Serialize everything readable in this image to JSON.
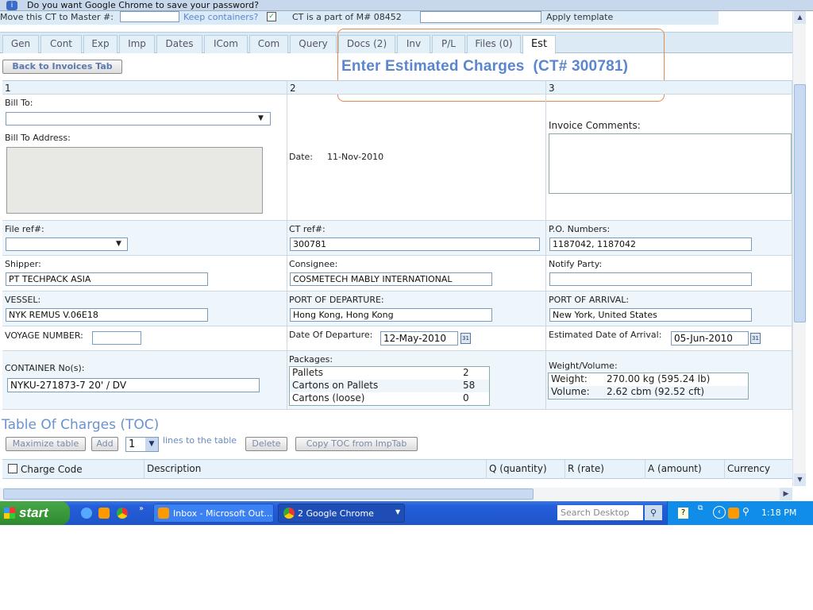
{
  "infobar": {
    "text": "Do you want Google Chrome to save your password?"
  },
  "toolbar": {
    "move_label": "Move this CT to Master #:",
    "keep_containers": "Keep containers?",
    "part_of": "CT is a part of M# 08452",
    "apply_template": "Apply template"
  },
  "tabs": [
    {
      "label": "Gen"
    },
    {
      "label": "Cont"
    },
    {
      "label": "Exp"
    },
    {
      "label": "Imp"
    },
    {
      "label": "Dates"
    },
    {
      "label": "ICom"
    },
    {
      "label": "Com"
    },
    {
      "label": "Query"
    },
    {
      "label": "Docs (2)"
    },
    {
      "label": "Inv"
    },
    {
      "label": "P/L"
    },
    {
      "label": "Files (0)"
    },
    {
      "label": "Est"
    }
  ],
  "active_tab": "Est",
  "back_button": "Back to Invoices Tab",
  "page_title": "Enter Estimated Charges  (CT# 300781)",
  "columns": [
    "1",
    "2",
    "3"
  ],
  "form": {
    "bill_to_label": "Bill To:",
    "bill_to_value": "",
    "bill_to_address_label": "Bill To Address:",
    "date_label": "Date:",
    "date_value": "11-Nov-2010",
    "invoice_comments_label": "Invoice Comments:",
    "file_ref_label": "File ref#:",
    "file_ref_value": "",
    "ct_ref_label": "CT ref#:",
    "ct_ref_value": "300781",
    "po_label": "P.O. Numbers:",
    "po_value": "1187042, 1187042",
    "shipper_label": "Shipper:",
    "shipper_value": "PT TECHPACK ASIA",
    "consignee_label": "Consignee:",
    "consignee_value": "COSMETECH MABLY INTERNATIONAL",
    "notify_label": "Notify Party:",
    "notify_value": "",
    "vessel_label": "VESSEL:",
    "vessel_value": "NYK REMUS V.06E18",
    "pod_label": "PORT OF DEPARTURE:",
    "pod_value": "Hong Kong, Hong Kong",
    "poa_label": "PORT OF ARRIVAL:",
    "poa_value": "New York, United States",
    "voyage_label": "VOYAGE NUMBER:",
    "voyage_value": "",
    "dod_label": "Date Of Departure:",
    "dod_value": "12-May-2010",
    "eda_label": "Estimated Date of Arrival:",
    "eda_value": "05-Jun-2010",
    "container_label": "CONTAINER No(s):",
    "container_value": "NYKU-271873-7 20' / DV",
    "packages_label": "Packages:",
    "packages": [
      {
        "name": "Pallets",
        "count": "2"
      },
      {
        "name": "Cartons on Pallets",
        "count": "58"
      },
      {
        "name": "Cartons (loose)",
        "count": "0"
      }
    ],
    "wv_label": "Weight/Volume:",
    "weight_label": "Weight:",
    "weight_value": "270.00 kg (595.24 lb)",
    "volume_label": "Volume:",
    "volume_value": "2.62 cbm (92.52 cft)"
  },
  "toc": {
    "title": "Table Of Charges (TOC)",
    "maximize": "Maximize table",
    "add": "Add",
    "lines_value": "1",
    "lines_text": "lines to the table",
    "delete": "Delete",
    "copy": "Copy TOC from ImpTab",
    "headers": [
      "Charge Code",
      "Description",
      "Q (quantity)",
      "R (rate)",
      "A (amount)",
      "Currency"
    ]
  },
  "taskbar": {
    "start": "start",
    "outlook": "Inbox - Microsoft Out...",
    "chrome": "2 Google Chrome",
    "search_placeholder": "Search Desktop",
    "clock": "1:18 PM"
  },
  "colors": {
    "title": "#5a86d0",
    "highlight_outline": "#e08a50",
    "taskbar": "#245edb"
  }
}
